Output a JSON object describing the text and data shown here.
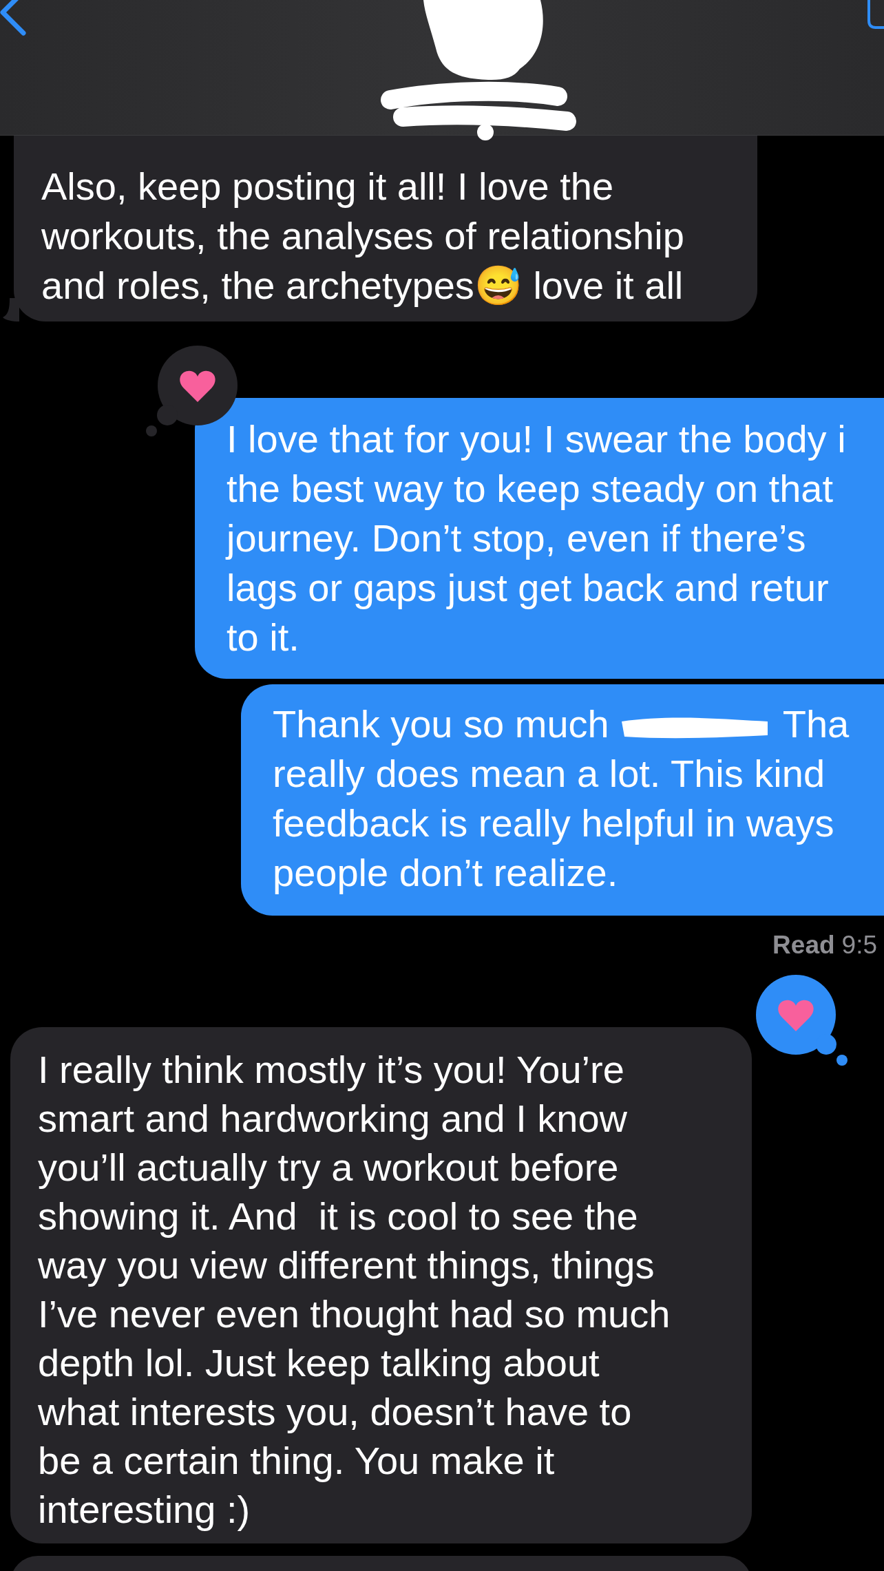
{
  "messages": [
    {
      "kind": "received",
      "tail": true,
      "segments": [
        {
          "kind": "block",
          "text": "Also, keep posting it all! I love the\nworkouts, the analyses of relationship\nand roles, the archetypes😅 love it all"
        }
      ]
    },
    {
      "kind": "sent",
      "reaction": {
        "kind": "heart"
      },
      "segments": [
        {
          "kind": "block",
          "text": "I love that for you! I swear the body i\nthe best way to keep steady on that\njourney. Don’t stop, even if there’s\nlags or gaps just get back and retur\nto it."
        }
      ]
    },
    {
      "kind": "sent",
      "segments": [
        {
          "kind": "text",
          "text": "Thank you so much"
        },
        {
          "kind": "redaction"
        },
        {
          "kind": "text",
          "text": "Tha"
        },
        {
          "kind": "block",
          "text": "really does mean a lot. This kind\nfeedback is really helpful in ways\npeople don’t realize."
        }
      ],
      "receipt": {
        "label": "Read",
        "time": "9:5"
      }
    },
    {
      "kind": "received",
      "reaction": {
        "kind": "heart"
      },
      "segments": [
        {
          "kind": "block",
          "text": "I really think mostly it’s you! You’re\nsmart and hardworking and I know\nyou’ll actually try a workout before\nshowing it. And  it is cool to see the\nway you view different things, things\nI’ve never even thought had so much\ndepth lol. Just keep talking about\nwhat interests you, doesn’t have to\nbe a certain thing. You make it\ninteresting :)"
        }
      ]
    },
    {
      "kind": "received"
    }
  ]
}
